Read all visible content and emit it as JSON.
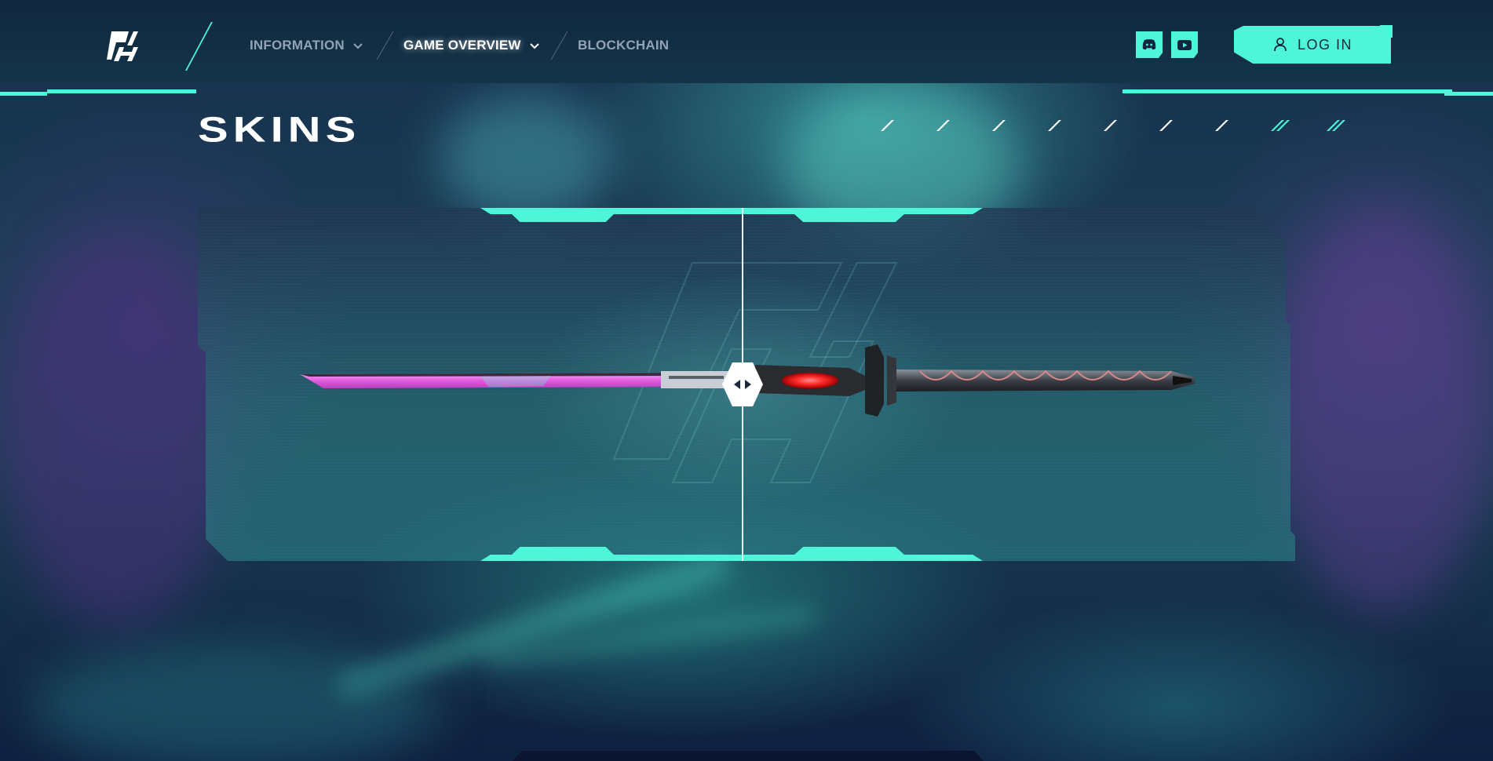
{
  "header": {
    "nav": [
      {
        "label": "INFORMATION",
        "has_dropdown": true,
        "active": false
      },
      {
        "label": "GAME OVERVIEW",
        "has_dropdown": true,
        "active": true
      },
      {
        "label": "BLOCKCHAIN",
        "has_dropdown": false,
        "active": false
      }
    ],
    "social": [
      {
        "icon": "discord-icon"
      },
      {
        "icon": "youtube-icon"
      }
    ],
    "login": {
      "label": "LOG IN",
      "icon": "user-icon"
    }
  },
  "page": {
    "title": "SKINS",
    "tick_count": 9,
    "accent_ticks": 2
  },
  "showcase": {
    "item": "katana-skin",
    "compare_handle": "compare-slider-handle"
  },
  "colors": {
    "accent": "#4ef5d9",
    "header_bg": "#10283f",
    "text_muted": "#93a3b6",
    "text_active": "#ffffff",
    "blade": "#e25ce0",
    "guard_glow": "#ff2a2a"
  }
}
